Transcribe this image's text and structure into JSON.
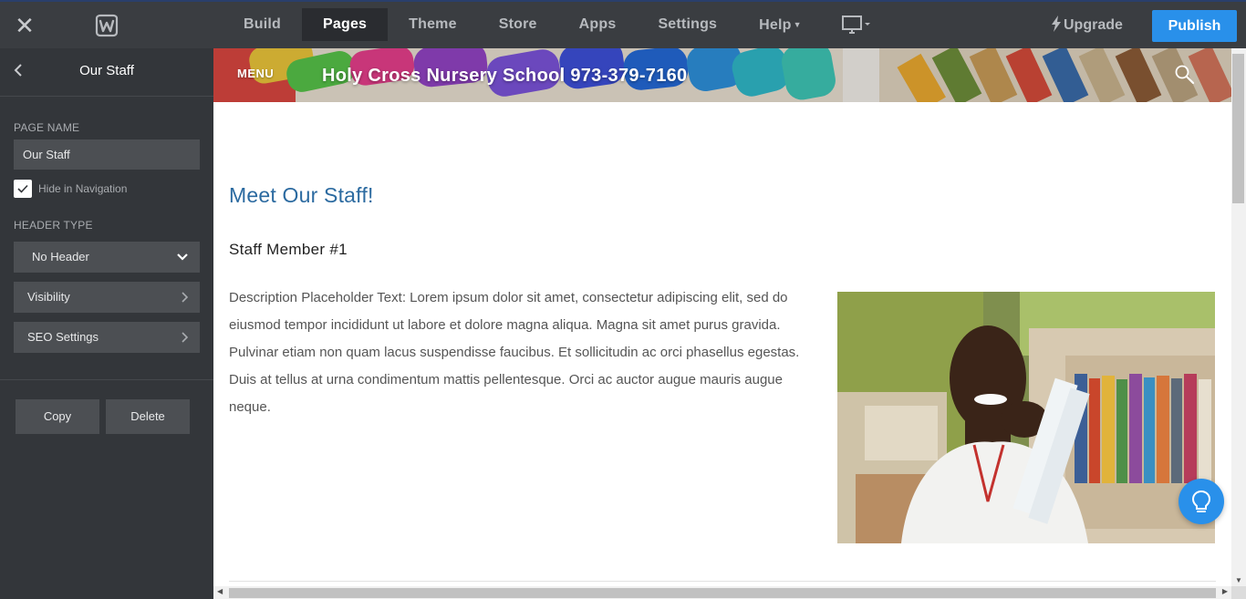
{
  "topbar": {
    "close_icon": "close-icon",
    "logo_icon": "weebly-logo-icon",
    "nav": [
      {
        "label": "Build",
        "active": false
      },
      {
        "label": "Pages",
        "active": true
      },
      {
        "label": "Theme",
        "active": false
      },
      {
        "label": "Store",
        "active": false
      },
      {
        "label": "Apps",
        "active": false
      },
      {
        "label": "Settings",
        "active": false
      },
      {
        "label": "Help",
        "active": false
      }
    ],
    "device_icon": "monitor-icon",
    "upgrade_label": "Upgrade",
    "publish_label": "Publish",
    "publish_color": "#2990ea"
  },
  "sidebar": {
    "title": "Our Staff",
    "page_name_label": "PAGE NAME",
    "page_name_value": "Our Staff",
    "hide_in_nav_label": "Hide in Navigation",
    "hide_in_nav_checked": true,
    "header_type_label": "HEADER TYPE",
    "header_type_value": "No Header",
    "visibility_label": "Visibility",
    "seo_label": "SEO Settings",
    "copy_label": "Copy",
    "delete_label": "Delete"
  },
  "preview": {
    "menu_label": "MENU",
    "site_title": "Holy Cross Nursery School   973-379-7160",
    "heading": "Meet Our Staff!",
    "staff_name": "Staff Member #1",
    "description": "Description Placeholder Text: Lorem ipsum dolor sit amet, consectetur adipiscing elit, sed do eiusmod tempor incididunt ut labore et dolore magna aliqua. Magna sit amet purus gravida. Pulvinar etiam non quam lacus suspendisse faucibus. Et sollicitudin ac orci phasellus egestas. Duis at tellus at urna condimentum mattis pellentesque. Orci ac auctor augue mauris augue neque.",
    "heading_color": "#2b6aa0"
  }
}
